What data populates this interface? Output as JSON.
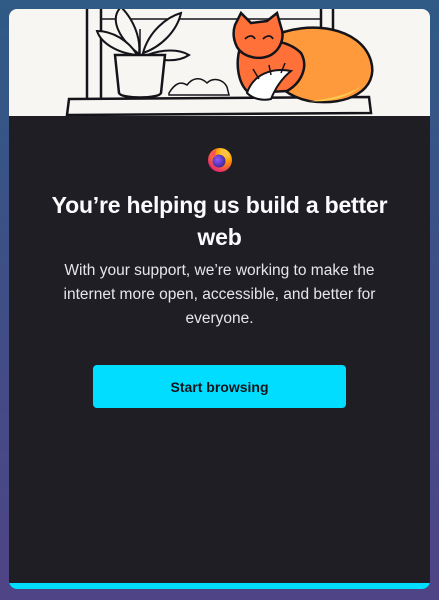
{
  "dialog": {
    "title": "You’re helping us build a better web",
    "subtitle": "With your support, we’re working to make the internet more open, accessible, and better for everyone.",
    "primary_button": "Start browsing",
    "progress": 1.0
  },
  "colors": {
    "accent": "#00ddff",
    "dialog_background": "#1f1e25",
    "hero_background": "#f7f6f2",
    "fox_orange": "#ff7139"
  },
  "icons": {
    "logo": "firefox-logo-icon",
    "hero": "fox-illustration"
  }
}
